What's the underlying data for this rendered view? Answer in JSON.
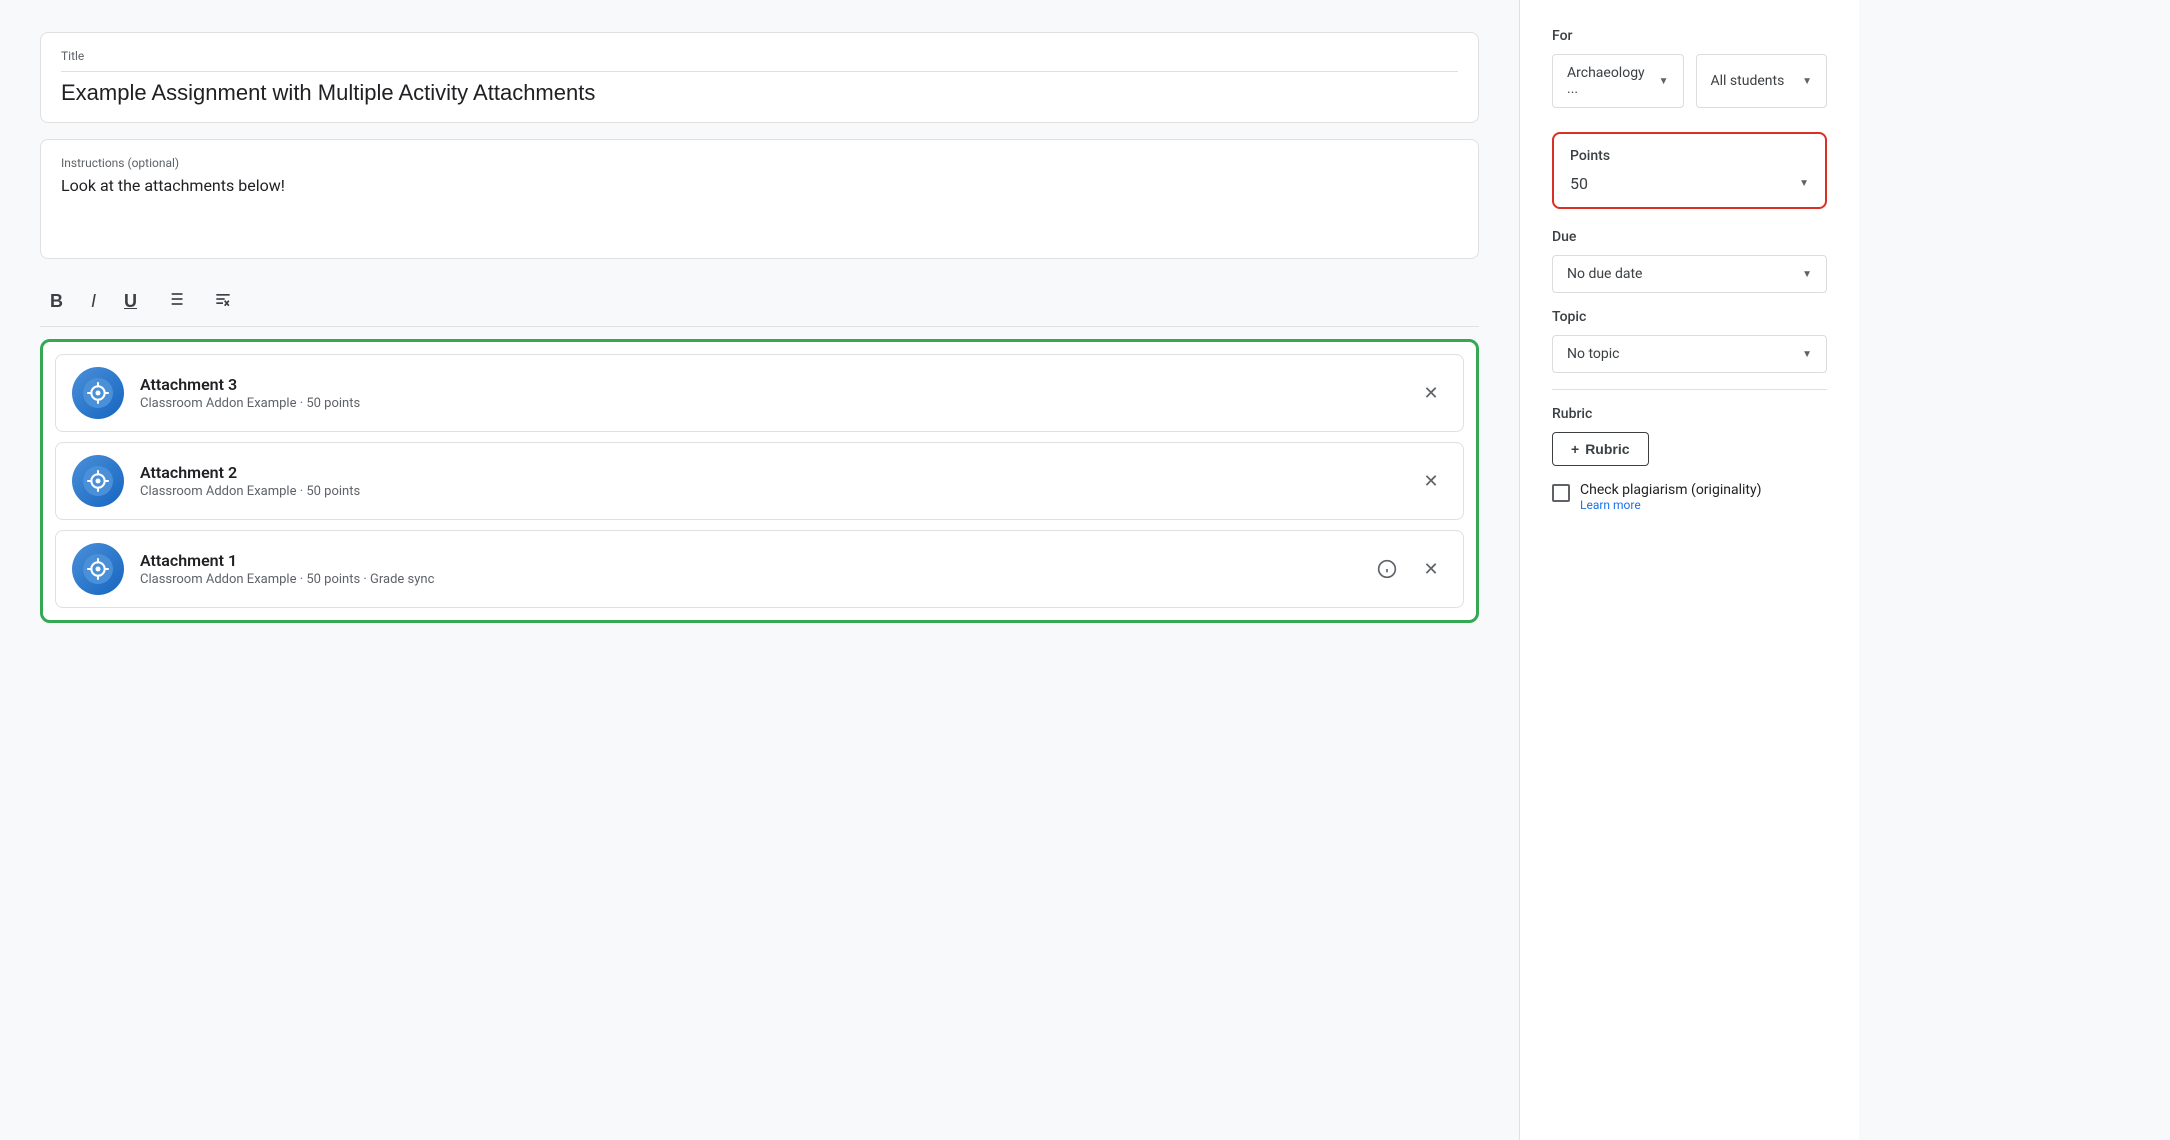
{
  "main": {
    "title_label": "Title",
    "title_value": "Example Assignment with Multiple Activity Attachments",
    "instructions_label": "Instructions (optional)",
    "instructions_value": "Look at the attachments below!",
    "toolbar": {
      "bold": "B",
      "italic": "I",
      "underline": "U",
      "list": "≡",
      "clear": "✕"
    },
    "attachments": [
      {
        "name": "Attachment 3",
        "meta": "Classroom Addon Example · 50 points",
        "has_info": false
      },
      {
        "name": "Attachment 2",
        "meta": "Classroom Addon Example · 50 points",
        "has_info": false
      },
      {
        "name": "Attachment 1",
        "meta": "Classroom Addon Example · 50 points · Grade sync",
        "has_info": true
      }
    ]
  },
  "sidebar": {
    "for_label": "For",
    "class_dropdown": "Archaeology ...",
    "students_dropdown": "All students",
    "points_label": "Points",
    "points_value": "50",
    "due_label": "Due",
    "due_dropdown": "No due date",
    "topic_label": "Topic",
    "topic_dropdown": "No topic",
    "rubric_label": "Rubric",
    "rubric_btn": "+ Rubric",
    "plagiarism_title": "Check plagiarism (originality)",
    "plagiarism_link": "Learn more"
  }
}
